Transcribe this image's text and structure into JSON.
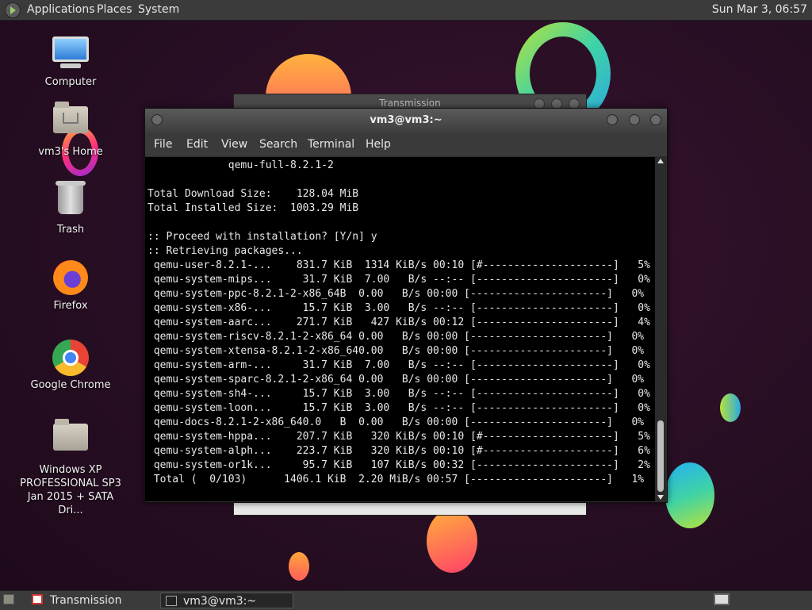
{
  "top_panel": {
    "menus": [
      "Applications",
      "Places",
      "System"
    ],
    "clock": "Sun Mar  3, 06:57"
  },
  "desktop_icons": [
    {
      "label": "Computer",
      "icon": "computer-icon"
    },
    {
      "label": "vm3's Home",
      "icon": "home-folder-icon"
    },
    {
      "label": "Trash",
      "icon": "trash-icon"
    },
    {
      "label": "Firefox",
      "icon": "firefox-icon"
    },
    {
      "label": "Google Chrome",
      "icon": "chrome-icon"
    },
    {
      "label": "Windows XP PROFESSIONAL SP3 Jan 2015 + SATA Dri...",
      "icon": "folder-icon"
    }
  ],
  "back_window": {
    "title": "Transmission"
  },
  "terminal": {
    "title": "vm3@vm3:~",
    "menu": [
      "File",
      "Edit",
      "View",
      "Search",
      "Terminal",
      "Help"
    ],
    "lines": [
      "             qemu-full-8.2.1-2",
      "",
      "Total Download Size:    128.04 MiB",
      "Total Installed Size:  1003.29 MiB",
      "",
      ":: Proceed with installation? [Y/n] y",
      ":: Retrieving packages...",
      " qemu-user-8.2.1-...    831.7 KiB  1314 KiB/s 00:10 [#---------------------]   5%",
      " qemu-system-mips...     31.7 KiB  7.00   B/s --:-- [----------------------]   0%",
      " qemu-system-ppc-8.2.1-2-x86_64B  0.00   B/s 00:00 [----------------------]   0%",
      " qemu-system-x86-...     15.7 KiB  3.00   B/s --:-- [----------------------]   0%",
      " qemu-system-aarc...    271.7 KiB   427 KiB/s 00:12 [----------------------]   4%",
      " qemu-system-riscv-8.2.1-2-x86_64 0.00   B/s 00:00 [----------------------]   0%",
      " qemu-system-xtensa-8.2.1-2-x86_640.00   B/s 00:00 [----------------------]   0%",
      " qemu-system-arm-...     31.7 KiB  7.00   B/s --:-- [----------------------]   0%",
      " qemu-system-sparc-8.2.1-2-x86_64 0.00   B/s 00:00 [----------------------]   0%",
      " qemu-system-sh4-...     15.7 KiB  3.00   B/s --:-- [----------------------]   0%",
      " qemu-system-loon...     15.7 KiB  3.00   B/s --:-- [----------------------]   0%",
      " qemu-docs-8.2.1-2-x86_640.0   B  0.00   B/s 00:00 [----------------------]   0%",
      " qemu-system-hppa...    207.7 KiB   320 KiB/s 00:10 [#---------------------]   5%",
      " qemu-system-alph...    223.7 KiB   320 KiB/s 00:10 [#---------------------]   6%",
      " qemu-system-or1k...     95.7 KiB   107 KiB/s 00:32 [----------------------]   2%",
      " Total (  0/103)      1406.1 KiB  2.20 MiB/s 00:57 [----------------------]   1%"
    ]
  },
  "taskbar": {
    "items": [
      {
        "label": "Transmission",
        "icon": "transmission-icon",
        "active": false
      },
      {
        "label": "vm3@vm3:~",
        "icon": "terminal-icon",
        "active": true
      }
    ]
  }
}
